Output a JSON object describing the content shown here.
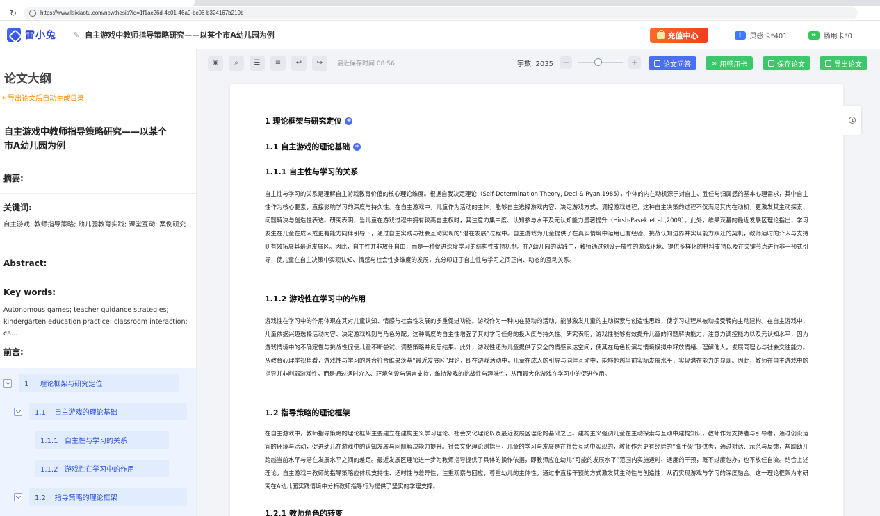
{
  "browser": {
    "url": "https://www.leixiaotu.com/newthesis?id=1f1ac26d-4c01-46a0-bc06-b324167b210b"
  },
  "header": {
    "logo_text": "雷小兔",
    "doc_title": "自主游戏中教师指导策略研究——以某个市A幼儿园为例",
    "recharge_label": "充值中心",
    "inspiration_card": "灵感卡*401",
    "free_card": "畅用卡*0"
  },
  "sidebar": {
    "title": "论文大纲",
    "note": "* 导出论文后自动生成目录",
    "paper_title": "自主游戏中教师指导策略研究——以某个市A幼儿园为例",
    "abstract_label": "摘要:",
    "keywords_label": "关键词:",
    "keywords": "自主游戏; 教师指导策略; 幼儿园教育实践; 课堂互动; 案例研究",
    "abstract_en_label": "Abstract:",
    "keywords_en_label": "Key words:",
    "keywords_en": "Autonomous games; teacher guidance strategies; kindergarten education practice; classroom interaction; ca...",
    "preface_label": "前言:",
    "outline": [
      {
        "num": "1",
        "label": "理论框架与研究定位"
      },
      {
        "num": "1.1",
        "label": "自主游戏的理论基础"
      },
      {
        "num": "1.1.1",
        "label": "自主性与学习的关系"
      },
      {
        "num": "1.1.2",
        "label": "游戏性在学习中的作用"
      },
      {
        "num": "1.2",
        "label": "指导策略的理论框架"
      }
    ]
  },
  "toolbar": {
    "saved_time": "最近保存时间 08:56",
    "word_count": "字数: 2035",
    "qa_button": "论文问答",
    "card_button": "用畅用卡",
    "save_button": "保存论文",
    "export_button": "导出论文",
    "zoom_level": 0.45
  },
  "document": {
    "h1": "1 理论框架与研究定位",
    "h1_1": "1.1 自主游戏的理论基础",
    "h1_1_1": "1.1.1 自主性与学习的关系",
    "p1": "自主性与学习的关系是理解自主游戏教育价值的核心理论维度。根据自我决定理论（Self-Determination Theory, Deci & Ryan,1985），个体的内在动机源于对自主、胜任与归属感的基本心理需求，其中自主性作为核心要素，直接影响学习的深度与持久性。在自主游戏中，儿童作为活动的主体，能够自主选择游戏内容、决定游戏方式、调控游戏进程，这种自主决策的过程不仅满足其内在动机，更激发其主动探索、问题解决与创造性表达。研究表明，当儿童在游戏过程中拥有较高自主权时，其注意力集中度、认知参与水平及元认知能力显著提升（Hirsh-Pasek et al.,2009）。此外，维果茨基的最近发展区理论指出，学习发生在儿童在成人或更有能力同伴引导下，通过自主实践与社会互动实现的“潜在发展”过程中。自主游戏为儿童提供了在真实情境中运用已有经验、挑战认知边界并实现能力跃迁的契机，教师适时的介入与支持则有效拓展其最近发展区。因此，自主性并非放任自由，而是一种促进深度学习的结构性支持机制。在A幼儿园的实践中，教师通过创设开放性的游戏环境、提供多样化的材料支持以及在关键节点进行非干预式引导，使儿童在自主决策中实现认知、情感与社会性多维度的发展，充分印证了自主性与学习之间正向、动态的互动关系。",
    "h1_1_2": "1.1.2 游戏性在学习中的作用",
    "p2": "游戏性在学习中的作用体现在其对儿童认知、情感与社会性发展的多重促进功能。游戏作为一种内在驱动的活动，能够激发儿童的主动探索与创造性思维，使学习过程从被动接受转向主动建构。在自主游戏中，儿童依据兴趣选择活动内容、决定游戏规则与角色分配，这种高度的自主性增强了其对学习任务的投入度与持久性。研究表明，游戏性能够有效提升儿童的问题解决能力、注意力调控能力以及元认知水平，因为游戏情境中的不确定性与挑战性促使儿童不断尝试、调整策略并反思结果。此外，游戏性还为儿童提供了安全的情感表达空间，使其在角色扮演与情境模拟中释放情绪、理解他人，发展同理心与社会交往能力。从教育心理学视角看，游戏性与学习的融合符合维果茨基“最近发展区”理论，即在游戏活动中，儿童在成人的引导与同伴互动中，能够超越当前实际发展水平，实现潜在能力的显现。因此，教师在自主游戏中的指导并非削弱游戏性，而是通过适时介入、环境创设与语言支持，维持游戏的挑战性与趣味性，从而最大化游戏在学习中的促进作用。",
    "h1_2": "1.2 指导策略的理论框架",
    "p3": "在自主游戏中，教师指导策略的理论框架主要建立在建构主义学习理论、社会文化理论以及最近发展区理论的基础之上。建构主义强调儿童在主动探索与互动中建构知识，教师作为支持者与引导者，通过创设适宜的环境与活动，促进幼儿在游戏中的认知发展与问题解决能力提升。社会文化理论则指出，儿童的学习与发展是在社会互动中实现的，教师作为更有经验的“脚手架”提供者，通过对话、示范与反馈，帮助幼儿跨越当前水平与潜在发展水平之间的差距。最近发展区理论进一步为教师指导提供了具体的操作依据，即教师应在幼儿“可能的发展水平”范围内实施适时、适度的干预，既不过度包办，也不放任自流。结合上述理论，自主游戏中教师的指导策略应体现支持性、适时性与差异性，注重观察与回应，尊重幼儿的主体性，通过非直接干预的方式激发其主动性与创造性，从而实现游戏与学习的深度融合。这一理论框架为本研究在A幼儿园实践情境中分析教师指导行为提供了坚实的学理支撑。",
    "h1_2_1": "1.2.1 教师角色的转变"
  }
}
